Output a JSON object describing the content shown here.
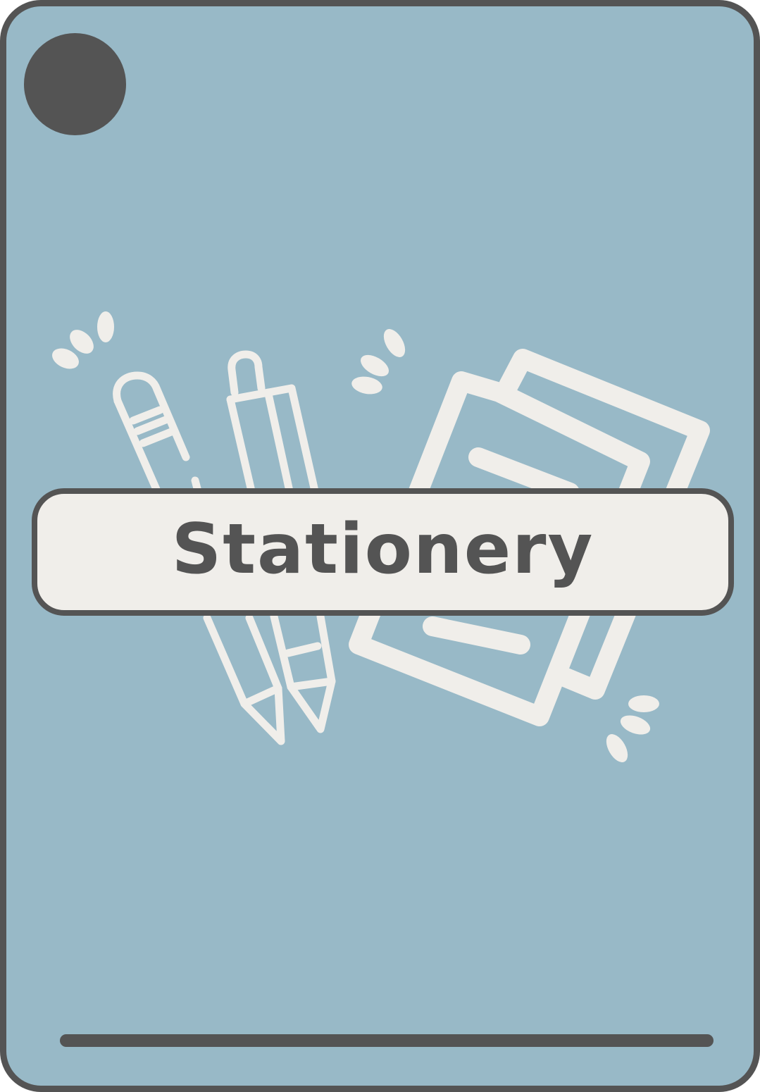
{
  "card": {
    "title": "Stationery",
    "colors": {
      "background": "#98b9c7",
      "border": "#545454",
      "banner": "#f0eeea",
      "illustration": "#f0eeea",
      "text": "#545454"
    },
    "illustration": {
      "icons": [
        "pencil-icon",
        "pen-icon",
        "notepad-icon",
        "sparkle-icon"
      ]
    }
  }
}
